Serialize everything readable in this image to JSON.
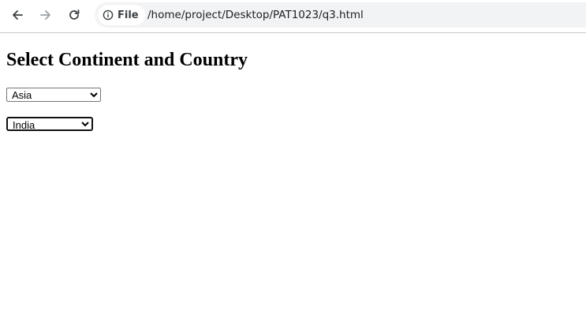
{
  "browser": {
    "back_icon": "arrow-left-icon",
    "forward_icon": "arrow-right-icon",
    "reload_icon": "reload-icon",
    "site_info_icon": "info-icon",
    "site_chip_label": "File",
    "url": "/home/project/Desktop/PAT1023/q3.html"
  },
  "page": {
    "title": "Select Continent and Country",
    "continent_select": {
      "selected": "Asia",
      "options": [
        "Asia"
      ]
    },
    "country_select": {
      "selected": "India",
      "options": [
        "India"
      ]
    }
  }
}
